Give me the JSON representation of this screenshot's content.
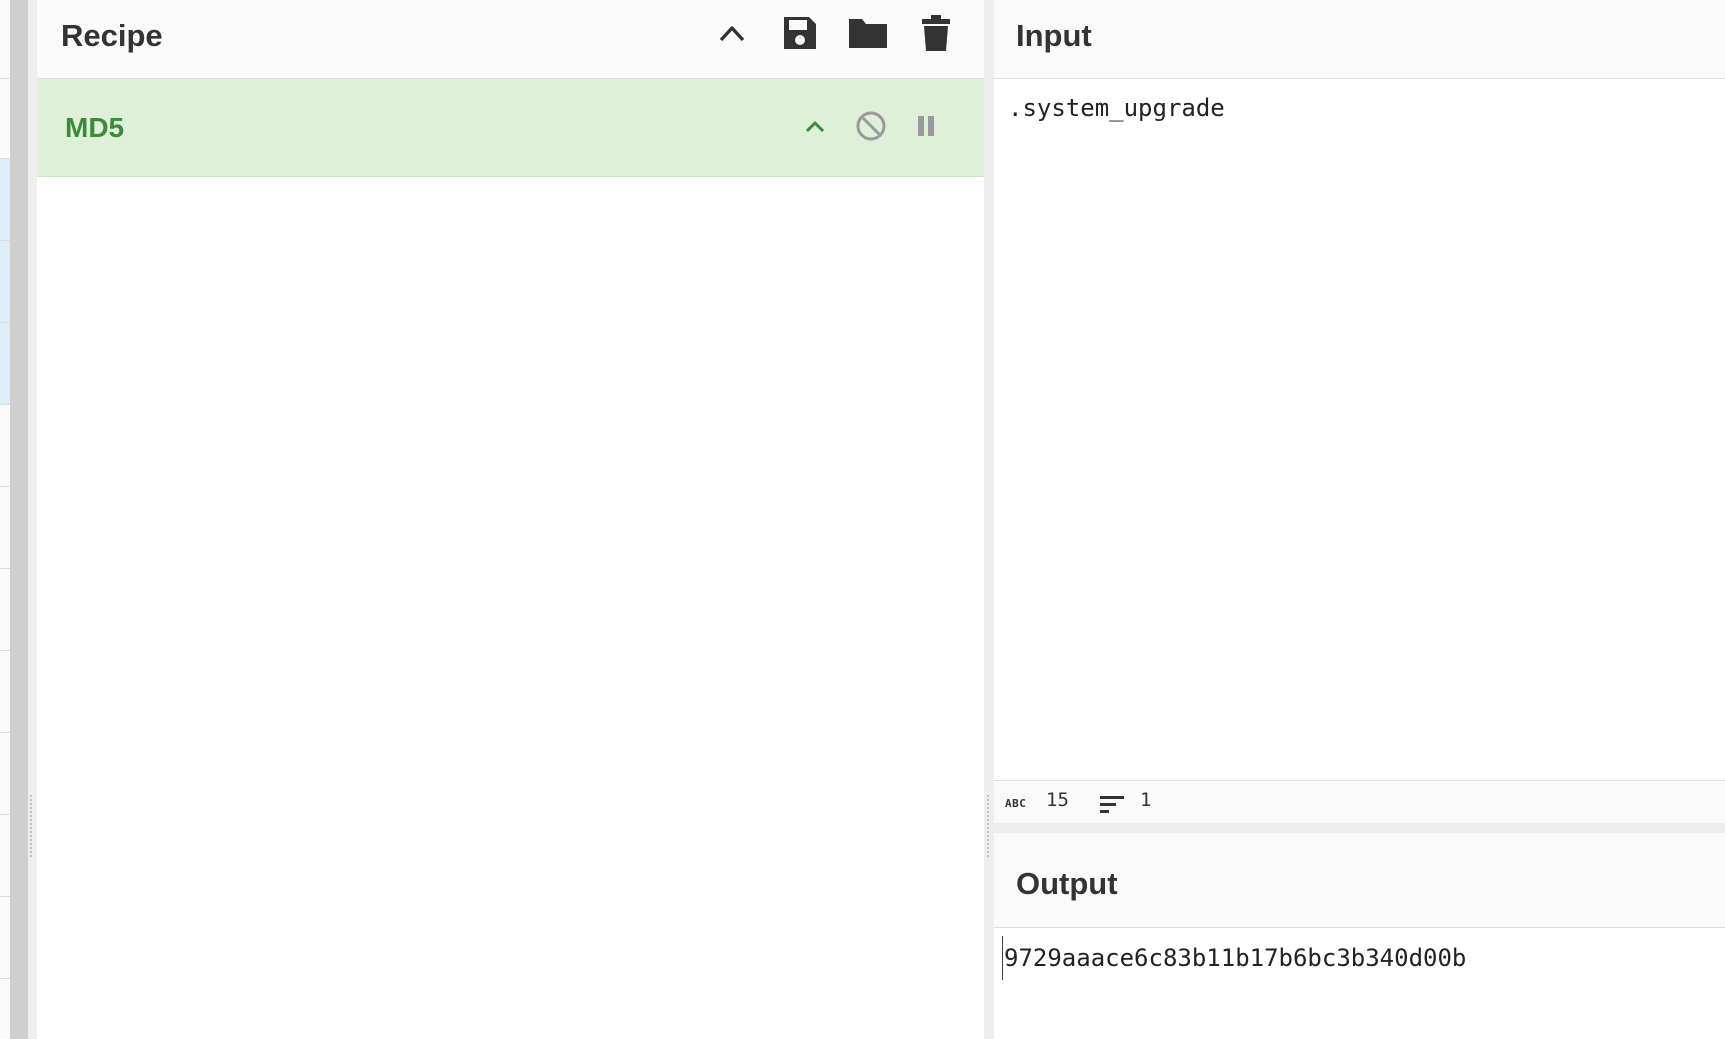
{
  "recipe": {
    "title": "Recipe",
    "icons": {
      "collapse": "chevron-up-icon",
      "save": "save-icon",
      "load": "folder-icon",
      "clear": "trash-icon"
    },
    "operations": [
      {
        "name": "MD5",
        "icons": [
          "chevron-up-icon",
          "disable-icon",
          "pause-icon"
        ]
      }
    ]
  },
  "input": {
    "title": "Input",
    "value": ".system_upgrade",
    "status": {
      "length": "15",
      "lines": "1",
      "length_icon_label": "ABC"
    }
  },
  "output": {
    "title": "Output",
    "value": "9729aaace6c83b11b17b6bc3b340d00b"
  },
  "colors": {
    "op_card_bg": "#dff0d8",
    "op_name": "#3c8a3c",
    "header_bg": "#fafafa",
    "text": "#333333"
  }
}
